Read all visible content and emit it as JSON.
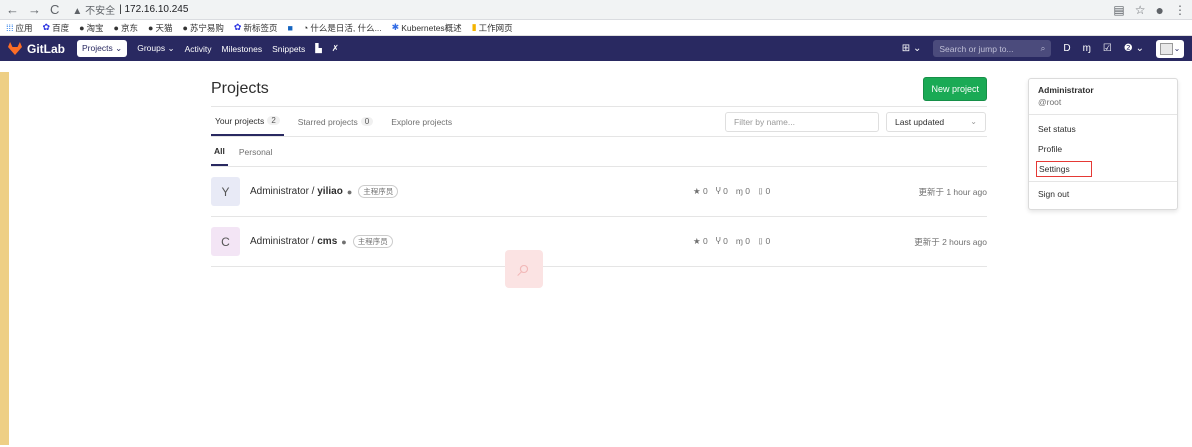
{
  "browser": {
    "back": "←",
    "forward": "→",
    "reload": "C",
    "security_warning": "▲ 不安全",
    "url": "172.16.10.245",
    "translate_icon": "translate-icon",
    "star_icon": "star-icon",
    "account_icon": "account-icon"
  },
  "bookmarks": [
    {
      "icon": "⁞⁞⁞",
      "label": "应用"
    },
    {
      "icon": "✿",
      "label": "百度"
    },
    {
      "icon": "●",
      "label": "淘宝"
    },
    {
      "icon": "●",
      "label": "京东"
    },
    {
      "icon": "●",
      "label": "天猫"
    },
    {
      "icon": "●",
      "label": "苏宁易购"
    },
    {
      "icon": "✿",
      "label": "新标签页"
    },
    {
      "icon": "■",
      "label": ""
    },
    {
      "icon": "◔",
      "label": "什么是日活, 什么..."
    },
    {
      "icon": "✱",
      "label": "Kubernetes概述"
    },
    {
      "icon": "▮",
      "label": "工作网页"
    }
  ],
  "gitlab_nav": {
    "brand": "GitLab",
    "items": [
      {
        "label": "Projects ⌄",
        "active": true
      },
      {
        "label": "Groups ⌄",
        "active": false
      },
      {
        "label": "Activity",
        "active": false
      },
      {
        "label": "Milestones",
        "active": false
      },
      {
        "label": "Snippets",
        "active": false
      },
      {
        "label": "▙",
        "active": false
      },
      {
        "label": "✗",
        "active": false
      }
    ],
    "plus_label": "⊞ ⌄",
    "search_placeholder": "Search or jump to...",
    "search_icon": "⌕",
    "icons": [
      "D",
      "ɱ",
      "☑",
      "❷ ⌄"
    ]
  },
  "page": {
    "title": "Projects",
    "new_project_label": "New project",
    "tabs": [
      {
        "label": "Your projects",
        "count": "2",
        "active": true
      },
      {
        "label": "Starred projects",
        "count": "0",
        "active": false
      },
      {
        "label": "Explore projects",
        "count": "",
        "active": false
      }
    ],
    "filter_placeholder": "Filter by name...",
    "sort_label": "Last updated",
    "subtabs": [
      {
        "label": "All",
        "active": true
      },
      {
        "label": "Personal",
        "active": false
      }
    ],
    "projects": [
      {
        "letter": "Y",
        "avatar_color": "#e8eaf6",
        "namespace": "Administrator / ",
        "name": "yiliao",
        "role": "主程序员",
        "stars": "★ 0",
        "forks": "Ⴤ 0",
        "mrs": "ɱ 0",
        "issues": "⌷ 0",
        "updated": "更新于 1 hour ago"
      },
      {
        "letter": "C",
        "avatar_color": "#f3e5f5",
        "namespace": "Administrator / ",
        "name": "cms",
        "role": "主程序员",
        "stars": "★ 0",
        "forks": "Ⴤ 0",
        "mrs": "ɱ 0",
        "issues": "⌷ 0",
        "updated": "更新于 2 hours ago"
      }
    ]
  },
  "user_menu": {
    "name": "Administrator",
    "username": "@root",
    "items": [
      "Set status",
      "Profile",
      "Settings",
      "Sign out"
    ]
  }
}
